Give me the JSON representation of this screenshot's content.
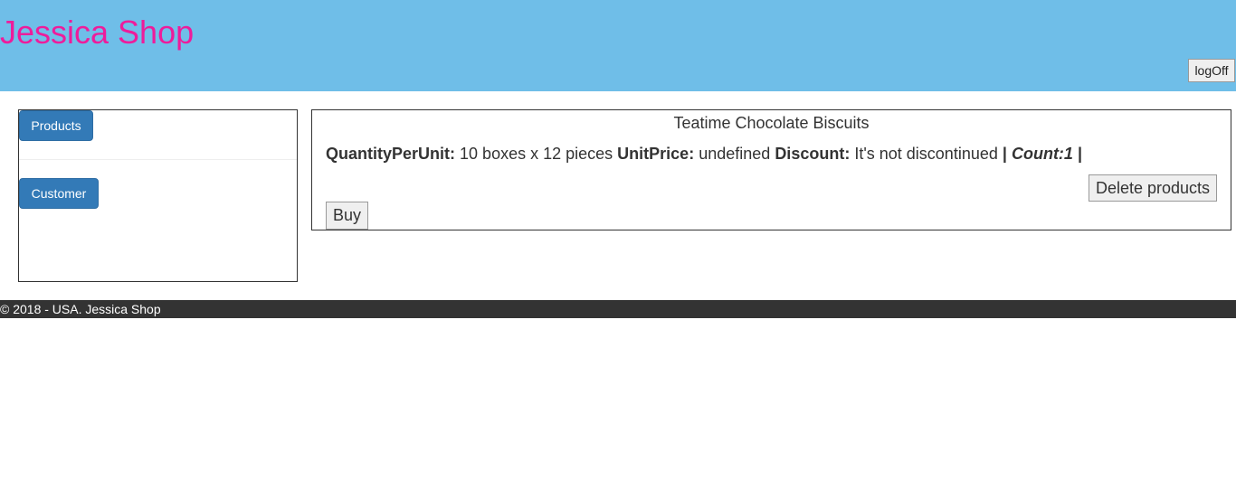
{
  "header": {
    "site_title": "Jessica Shop",
    "logoff_label": "logOff"
  },
  "sidebar": {
    "items": [
      {
        "label": "Products"
      },
      {
        "label": "Customer"
      }
    ]
  },
  "product": {
    "name": "Teatime Chocolate Biscuits",
    "quantity_label": "QuantityPerUnit:",
    "quantity_value": "10 boxes x 12 pieces",
    "price_label": "UnitPrice:",
    "price_value": "undefined",
    "discount_label": "Discount:",
    "discount_value": "It's not discontinued",
    "separator": "|",
    "count_text": "Count:1",
    "delete_label": "Delete products",
    "buy_label": "Buy"
  },
  "footer": {
    "text": "© 2018 - USA. Jessica Shop"
  },
  "colors": {
    "header_bg": "#6fbee8",
    "title_color": "#ee1c9b",
    "primary_button": "#337ab7",
    "footer_bg": "#333333"
  }
}
